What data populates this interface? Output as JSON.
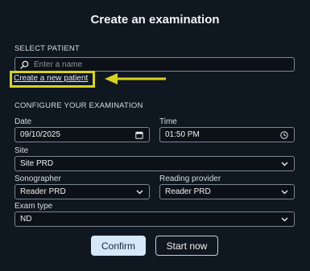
{
  "title": "Create an examination",
  "select_patient": {
    "section_label": "SELECT PATIENT",
    "search_placeholder": "Enter a name",
    "create_link": "Create a new patient"
  },
  "configure": {
    "section_label": "CONFIGURE YOUR EXAMINATION",
    "date": {
      "label": "Date",
      "value": "09/10/2025"
    },
    "time": {
      "label": "Time",
      "value": "01:50 PM"
    },
    "site": {
      "label": "Site",
      "value": "Site PRD"
    },
    "sonographer": {
      "label": "Sonographer",
      "value": "Reader PRD"
    },
    "reading_provider": {
      "label": "Reading provider",
      "value": "Reader PRD"
    },
    "exam_type": {
      "label": "Exam type",
      "value": "ND"
    }
  },
  "buttons": {
    "confirm": "Confirm",
    "start_now": "Start now"
  },
  "colors": {
    "background": "#0f1720",
    "highlight": "#d9d31d",
    "confirm_bg": "#d5e8fb"
  },
  "icons": [
    "search-icon",
    "calendar-icon",
    "clock-icon",
    "chevron-down-icon",
    "arrow-left-icon"
  ]
}
